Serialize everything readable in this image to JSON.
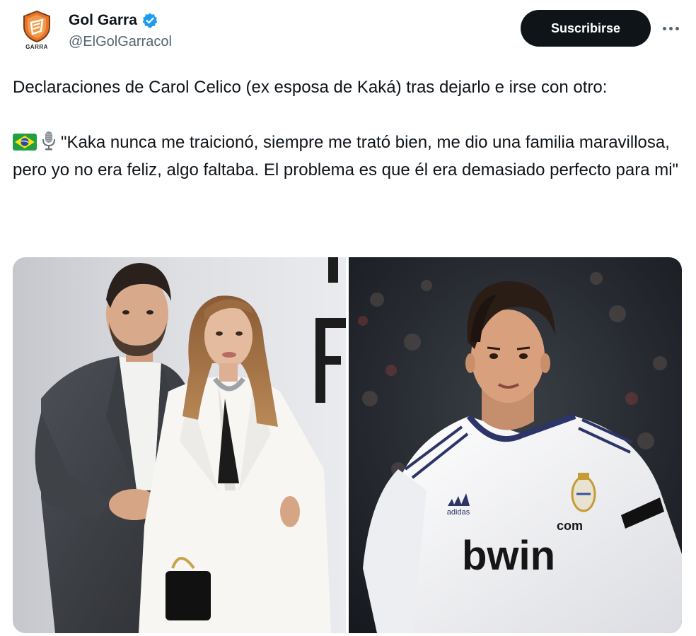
{
  "account": {
    "display_name": "Gol Garra",
    "handle": "@ElGolGarracol",
    "avatar_caption": "GARRA",
    "verified": true
  },
  "actions": {
    "subscribe_label": "Suscribirse",
    "more_icon": "more-horizontal-icon"
  },
  "tweet": {
    "line1": "Declaraciones de Carol Celico (ex esposa de Kaká) tras dejarlo e irse con otro:",
    "quote": "\"Kaka nunca me traicionó, siempre me trató bien, me dio una familia maravillosa, pero yo no era feliz, algo faltaba. El problema es que él era demasiado perfecto para mi\"",
    "quote_icons": [
      "brazil-flag-icon",
      "microphone-icon"
    ]
  },
  "media": {
    "photos": [
      "couple-photo",
      "footballer-photo"
    ],
    "shirt_sponsor": "bwin",
    "shirt_sponsor_suffix": "com",
    "kit_brand": "adidas"
  },
  "colors": {
    "brand_dark": "#0f1419",
    "secondary_text": "#536471",
    "verified_blue": "#1d9bf0",
    "avatar_orange": "#e8742a"
  }
}
